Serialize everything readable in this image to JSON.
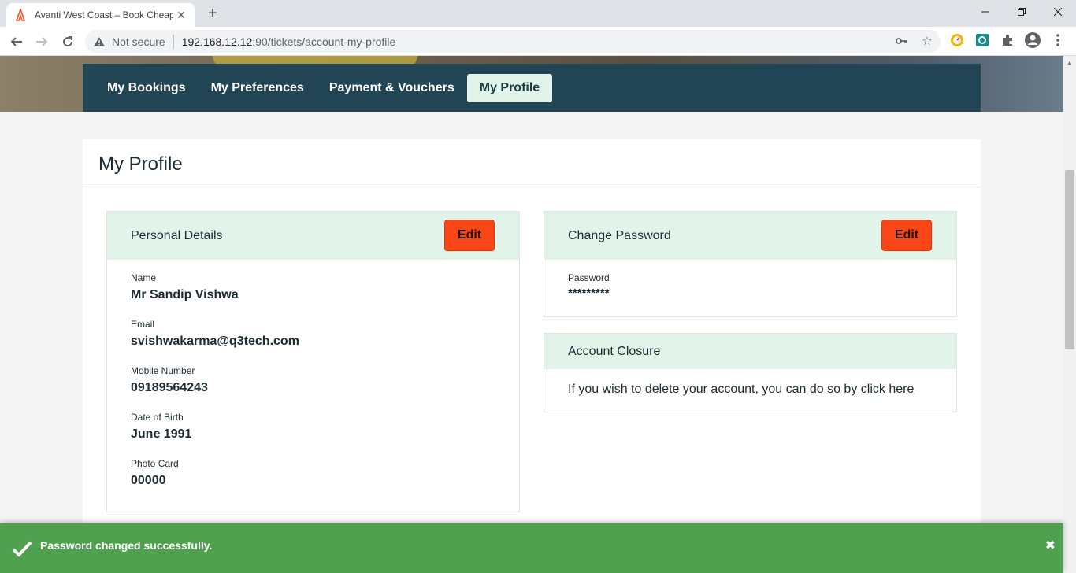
{
  "browser": {
    "tab_title": "Avanti West Coast – Book Cheap",
    "not_secure_label": "Not secure",
    "url_host": "192.168.12.12",
    "url_path": ":90/tickets/account-my-profile"
  },
  "subnav": {
    "items": [
      {
        "label": "My Bookings"
      },
      {
        "label": "My Preferences"
      },
      {
        "label": "Payment & Vouchers"
      },
      {
        "label": "My Profile"
      }
    ],
    "active_index": 3
  },
  "profile": {
    "title": "My Profile",
    "personal": {
      "heading": "Personal Details",
      "edit_label": "Edit",
      "fields": [
        {
          "label": "Name",
          "value": "Mr Sandip Vishwa"
        },
        {
          "label": "Email",
          "value": "svishwakarma@q3tech.com"
        },
        {
          "label": "Mobile Number",
          "value": "09189564243"
        },
        {
          "label": "Date of Birth",
          "value": "June 1991"
        },
        {
          "label": "Photo Card",
          "value": "00000"
        }
      ]
    },
    "password": {
      "heading": "Change Password",
      "edit_label": "Edit",
      "label": "Password",
      "value": "*********"
    },
    "closure": {
      "heading": "Account Closure",
      "text": "If you wish to delete your account, you can do so by ",
      "link": "click here"
    }
  },
  "toast": {
    "message": "Password changed successfully.",
    "close_glyph": "✖"
  },
  "colors": {
    "nav_bg": "#224555",
    "accent_orange": "#fa4616",
    "mint": "#e2f4e9",
    "toast_green": "#50a14f"
  }
}
